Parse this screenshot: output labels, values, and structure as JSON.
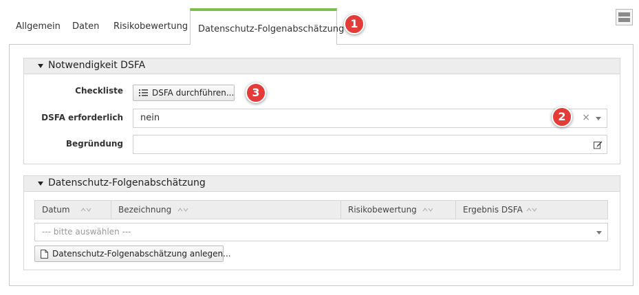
{
  "tabs": [
    {
      "label": "Allgemein"
    },
    {
      "label": "Daten"
    },
    {
      "label": "Risikobewertung"
    },
    {
      "label": "Datenschutz-Folgenabschätzung",
      "active": true
    }
  ],
  "callouts": [
    "1",
    "2",
    "3"
  ],
  "section_necessity": {
    "title": "Notwendigkeit DSFA",
    "checklist": {
      "label": "Checkliste",
      "button": "DSFA durchführen..."
    },
    "required": {
      "label": "DSFA erforderlich",
      "value": "nein",
      "clear_glyph": "×"
    },
    "reason": {
      "label": "Begründung",
      "value": ""
    }
  },
  "section_dsfa": {
    "title": "Datenschutz-Folgenabschätzung",
    "columns": [
      "Datum",
      "Bezeichnung",
      "Risikobewertung",
      "Ergebnis DSFA"
    ],
    "select_placeholder": "--- bitte auswählen ---",
    "create_button": "Datenschutz-Folgenabschätzung anlegen..."
  },
  "colors": {
    "accent": "#7dbf4e",
    "badge": "#e33b37"
  },
  "icons": [
    "list-icon",
    "edit-icon",
    "document-icon",
    "layout-toggle-icon",
    "sort-icon"
  ]
}
